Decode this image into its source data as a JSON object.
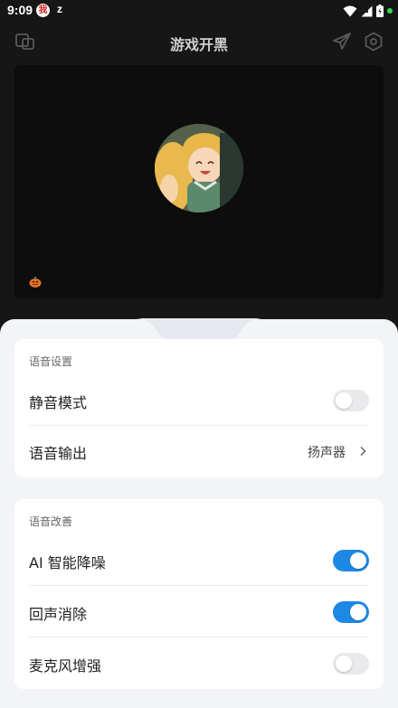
{
  "status_bar": {
    "time": "9:09",
    "app_icon_glyph": "我",
    "notification_glyph": "z",
    "dot_color": "#32d74b"
  },
  "header": {
    "title": "游戏开黑"
  },
  "voice_settings": {
    "section_title": "语音设置",
    "mute_label": "静音模式",
    "mute_on": false,
    "output_label": "语音输出",
    "output_value": "扬声器"
  },
  "voice_improve": {
    "section_title": "语音改善",
    "ai_noise_label": "AI 智能降噪",
    "ai_noise_on": true,
    "echo_label": "回声消除",
    "echo_on": true,
    "mic_boost_label": "麦克风增强",
    "mic_boost_on": false
  },
  "colors": {
    "accent": "#1e88e5",
    "sheet_bg": "#f3f4f8",
    "dark_bg": "#161616"
  }
}
